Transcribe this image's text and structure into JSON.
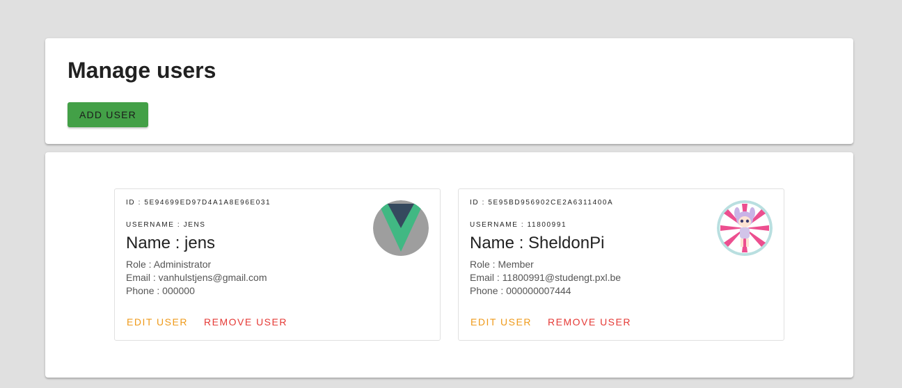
{
  "header": {
    "title": "Manage users",
    "add_user_label": "ADD USER"
  },
  "colors": {
    "background": "#e0e0e0",
    "add_button": "#43a047",
    "edit_action": "#ef9a1a",
    "remove_action": "#e53935"
  },
  "users": [
    {
      "id_line": "ID : 5E94699ED97D4A1A8E96E031",
      "username_line": "USERNAME : JENS",
      "name_line": "Name : jens",
      "role_line": "Role : Administrator",
      "email_line": "Email : vanhulstjens@gmail.com",
      "phone_line": "Phone : 000000",
      "avatar_icon": "vue-logo-avatar",
      "edit_label": "EDIT USER",
      "remove_label": "REMOVE USER"
    },
    {
      "id_line": "ID : 5E95BD956902CE2A6311400A",
      "username_line": "USERNAME : 11800991",
      "name_line": "Name : SheldonPi",
      "role_line": "Role : Member",
      "email_line": "Email : 11800991@studengt.pxl.be",
      "phone_line": "Phone : 000000007444",
      "avatar_icon": "doll-avatar",
      "edit_label": "EDIT USER",
      "remove_label": "REMOVE USER"
    }
  ]
}
